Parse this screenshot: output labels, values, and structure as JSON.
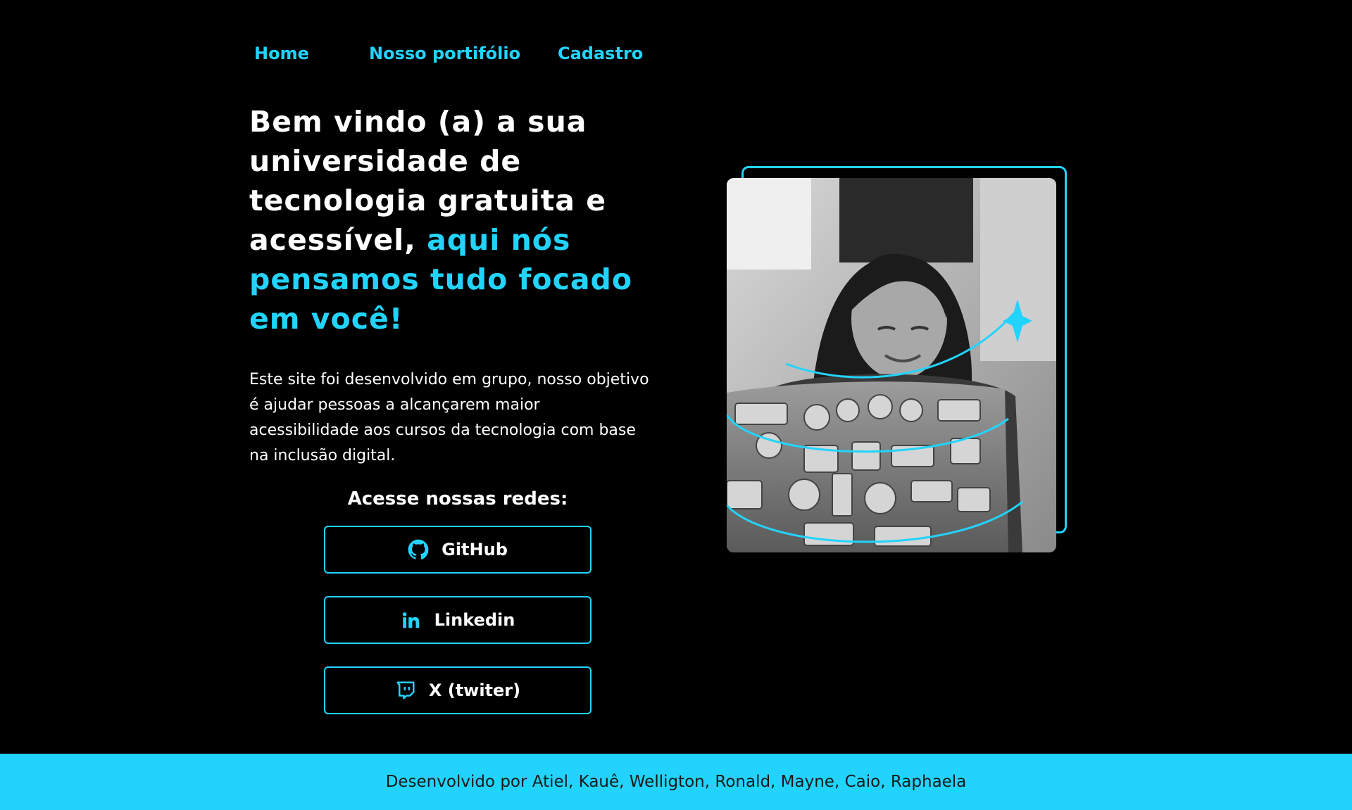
{
  "nav": {
    "items": [
      {
        "label": "Home"
      },
      {
        "label": "Nosso portifólio"
      },
      {
        "label": "Cadastro"
      }
    ]
  },
  "hero": {
    "title_part1": "Bem vindo (a) a sua universidade de tecnologia gratuita e acessível, ",
    "title_accent": "aqui nós pensamos tudo focado em você!",
    "description": "Este site foi desenvolvido em grupo, nosso objetivo é ajudar pessoas  a alcançarem maior acessibilidade  aos cursos da tecnologia com base na inclusão digital.",
    "social_title": "Acesse nossas redes:",
    "social_buttons": [
      {
        "label": "GitHub",
        "icon": "github-icon"
      },
      {
        "label": "Linkedin",
        "icon": "linkedin-icon"
      },
      {
        "label": "X (twiter)",
        "icon": "twitch-icon"
      }
    ]
  },
  "image": {
    "alt": "Mulher sorrindo usando um notebook com adesivos"
  },
  "footer": {
    "text": "Desenvolvido por Atiel, Kauê, Welligton, Ronald, Mayne, Caio, Raphaela"
  },
  "colors": {
    "background": "#000000",
    "accent": "#22D4FD",
    "text": "#FFFFFF",
    "footer_text": "#1A1A1A"
  }
}
